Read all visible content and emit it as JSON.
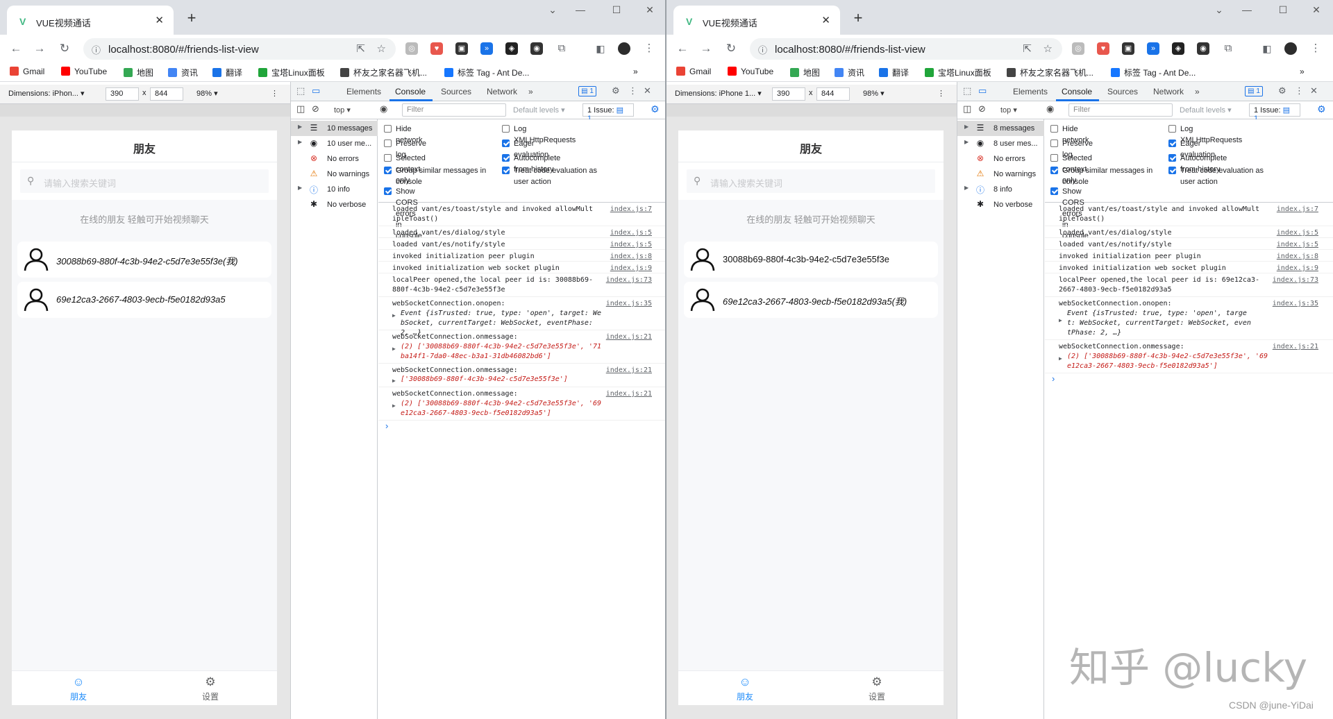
{
  "browser": {
    "tab_title": "VUE视频通话",
    "url": "localhost:8080/#/friends-list-view",
    "bookmarks": [
      "Gmail",
      "YouTube",
      "地图",
      "资讯",
      "翻译",
      "宝塔Linux面板",
      "杯友之家名器飞机...",
      "标签 Tag - Ant De..."
    ],
    "bookmark_more": "»"
  },
  "device_toolbar": {
    "left_dimensions": "Dimensions: iPhon...",
    "right_dimensions": "Dimensions: iPhone 1...",
    "width": "390",
    "times": "x",
    "height": "844",
    "zoom": "98%"
  },
  "phone": {
    "title": "朋友",
    "search_placeholder": "请输入搜索关键词",
    "hint": "在线的朋友 轻触可开始视频聊天",
    "left_friends": [
      "30088b69-880f-4c3b-94e2-c5d7e3e55f3e(我)",
      "69e12ca3-2667-4803-9ecb-f5e0182d93a5"
    ],
    "right_friends": [
      "30088b69-880f-4c3b-94e2-c5d7e3e55f3e",
      "69e12ca3-2667-4803-9ecb-f5e0182d93a5(我)"
    ],
    "tab_friends": "朋友",
    "tab_settings": "设置"
  },
  "devtools": {
    "tabs": [
      "Elements",
      "Console",
      "Sources",
      "Network"
    ],
    "badge": "1",
    "context": "top",
    "filter_placeholder": "Filter",
    "default_levels": "Default levels",
    "issue": "1 Issue:",
    "issue_count": "1",
    "settings": {
      "hide_network": "Hide network",
      "preserve_log": "Preserve log",
      "selected_context": "Selected context only",
      "group_similar": "Group similar messages in console",
      "show_cors": "Show CORS errors in console",
      "log_xhr": "Log XMLHttpRequests",
      "eager_eval": "Eager evaluation",
      "autocomplete": "Autocomplete from history",
      "treat_code": "Treat code evaluation as user action"
    },
    "left_sidebar": [
      "10 messages",
      "10 user me...",
      "No errors",
      "No warnings",
      "10 info",
      "No verbose"
    ],
    "right_sidebar": [
      "8 messages",
      "8 user mes...",
      "No errors",
      "No warnings",
      "8 info",
      "No verbose"
    ],
    "prompt": "›"
  },
  "logs": {
    "l1": "loaded vant/es/toast/style and invoked allowMultipleToast()",
    "l2": "loaded vant/es/dialog/style",
    "l3": "loaded vant/es/notify/style",
    "l4": "invoked initialization peer plugin",
    "l5": "invoked initialization web socket plugin",
    "l6": "localPeer opened,the local peer id is: 30088b69-880f-4c3b-94e2-c5d7e3e55f3e",
    "r6": "localPeer opened,the local peer id is: 69e12ca3-2667-4803-9ecb-f5e0182d93a5",
    "onopen": "webSocketConnection.onopen:",
    "event": "Event {isTrusted: true, type: 'open', target: WebSocket, currentTarget: WebSocket, eventPhase: 2, …}",
    "onmessage": "webSocketConnection.onmessage:",
    "m1": "(2) ['30088b69-880f-4c3b-94e2-c5d7e3e55f3e', '71ba14f1-7da0-48ec-b3a1-31db46082bd6']",
    "m2": "['30088b69-880f-4c3b-94e2-c5d7e3e55f3e']",
    "m3": "(2) ['30088b69-880f-4c3b-94e2-c5d7e3e55f3e', '69e12ca3-2667-4803-9ecb-f5e0182d93a5']",
    "src7": "index.js:7",
    "src5": "index.js:5",
    "src8": "index.js:8",
    "src9": "index.js:9",
    "src73": "index.js:73",
    "src35": "index.js:35",
    "src21": "index.js:21"
  },
  "watermark": "知乎 @lucky",
  "csdn": "CSDN @june-YiDai",
  "colors": {
    "accent": "#1a73e8",
    "vue": "#42b883",
    "active_tab": "#1989fa"
  }
}
